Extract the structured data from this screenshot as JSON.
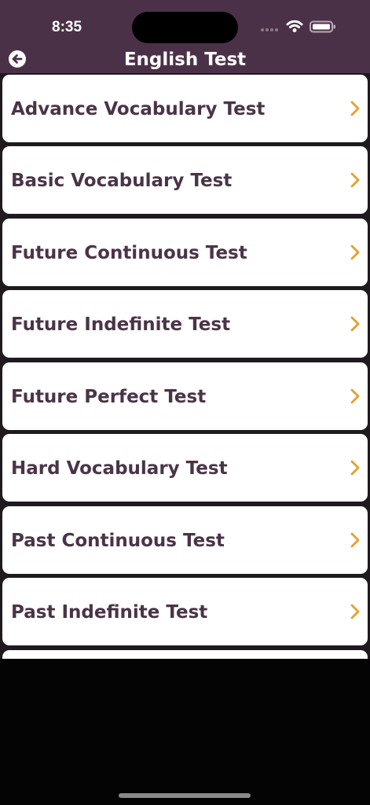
{
  "status_bar": {
    "time": "8:35",
    "wifi_icon": "wifi-icon",
    "battery_icon": "battery-icon"
  },
  "nav": {
    "back_icon": "back-arrow-circle-icon",
    "title": "English Test"
  },
  "colors": {
    "header_background": "#4b3147",
    "title_text": "#ffffff",
    "card_background": "#ffffff",
    "card_text": "#4a3448",
    "chevron": "#e2a12d"
  },
  "tests": [
    {
      "label": "Advance Vocabulary Test"
    },
    {
      "label": "Basic Vocabulary Test"
    },
    {
      "label": "Future Continuous Test"
    },
    {
      "label": "Future Indefinite Test"
    },
    {
      "label": "Future Perfect Test"
    },
    {
      "label": "Hard Vocabulary Test"
    },
    {
      "label": "Past Continuous Test"
    },
    {
      "label": "Past Indefinite Test"
    },
    {
      "label": ""
    }
  ]
}
